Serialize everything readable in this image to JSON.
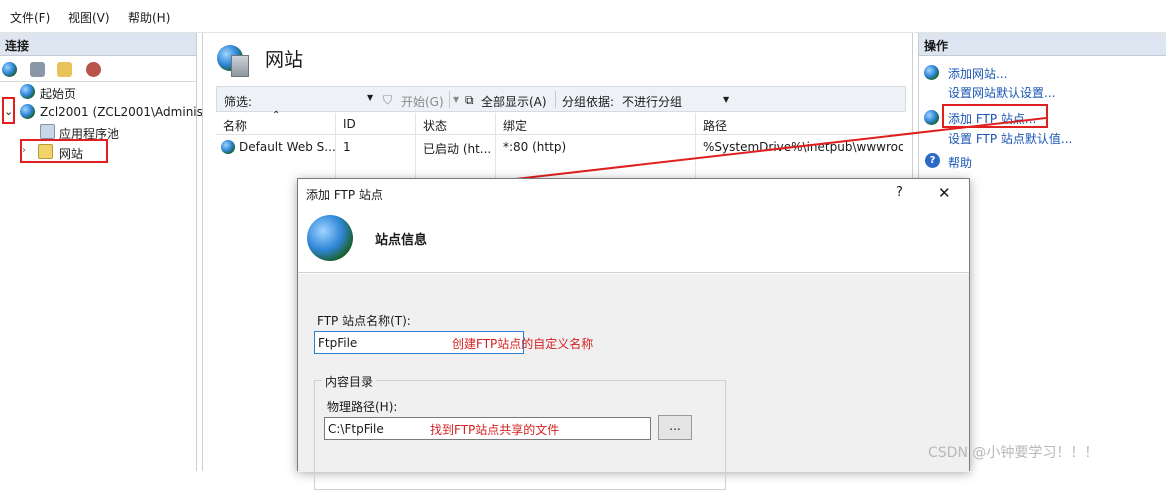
{
  "menu": {
    "file": "文件(F)",
    "view": "视图(V)",
    "help": "帮助(H)"
  },
  "left_pane": {
    "title": "连接",
    "tree": {
      "start_page": "起始页",
      "server": "Zcl2001 (ZCL2001\\Administ",
      "app_pools": "应用程序池",
      "sites": "网站"
    }
  },
  "center": {
    "title": "网站",
    "filter_label": "筛选:",
    "start_btn": "开始(G)",
    "show_all": "全部显示(A)",
    "group_by_label": "分组依据:",
    "group_by_value": "不进行分组",
    "columns": [
      "名称",
      "ID",
      "状态",
      "绑定",
      "路径"
    ],
    "rows": [
      {
        "name": "Default Web S...",
        "id": "1",
        "status": "已启动 (ht...",
        "binding": "*:80 (http)",
        "path": "%SystemDrive%\\inetpub\\wwwroot"
      }
    ]
  },
  "right_pane": {
    "title": "操作",
    "actions": {
      "add_site": "添加网站...",
      "site_defaults": "设置网站默认设置...",
      "add_ftp": "添加 FTP 站点...",
      "ftp_defaults": "设置 FTP 站点默认值...",
      "help": "帮助"
    }
  },
  "dialog": {
    "title": "添加 FTP 站点",
    "help_glyph": "?",
    "close_glyph": "✕",
    "header": "站点信息",
    "site_name_label": "FTP 站点名称(T):",
    "site_name_value": "FtpFile",
    "site_name_note": "创建FTP站点的自定义名称",
    "content_dir_label": "内容目录",
    "physical_path_label": "物理路径(H):",
    "physical_path_value": "C:\\FtpFile",
    "physical_path_note": "找到FTP站点共享的文件",
    "browse_label": "..."
  },
  "watermark": "CSDN @小钟要学习！！！",
  "colors": {
    "accent_link": "#1a55b4",
    "annotation_red": "#e02020"
  }
}
